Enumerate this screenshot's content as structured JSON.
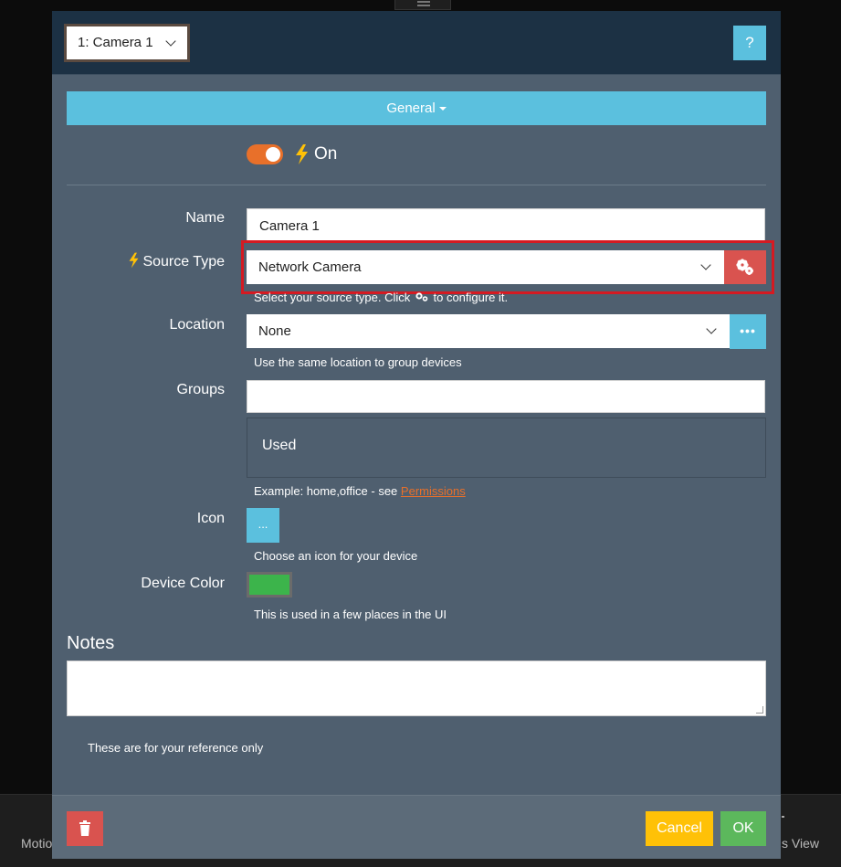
{
  "background": {
    "left_label": "Motio",
    "right_label": "s View"
  },
  "header": {
    "monitor_select_value": "1: Camera 1",
    "help_label": "?"
  },
  "tab": {
    "label": "General"
  },
  "enabled": {
    "state": true,
    "label": "On"
  },
  "fields": {
    "name": {
      "label": "Name",
      "value": "Camera 1"
    },
    "source_type": {
      "label": "Source Type",
      "value": "Network Camera",
      "help_before": "Select your source type. Click",
      "help_after": "to configure it."
    },
    "location": {
      "label": "Location",
      "value": "None",
      "more_label": "•••",
      "help": "Use the same location to group devices"
    },
    "groups": {
      "label": "Groups",
      "value": "",
      "used_label": "Used",
      "help_prefix": "Example: home,office - see",
      "help_link": "Permissions"
    },
    "icon": {
      "label": "Icon",
      "button_label": "...",
      "help": "Choose an icon for your device"
    },
    "device_color": {
      "label": "Device Color",
      "value": "#3cb44b",
      "help": "This is used in a few places in the UI"
    }
  },
  "notes": {
    "label": "Notes",
    "value": "",
    "help": "These are for your reference only"
  },
  "footer": {
    "cancel_label": "Cancel",
    "ok_label": "OK"
  },
  "colors": {
    "accent_info": "#5bc0de",
    "accent_danger": "#d9534f",
    "accent_warning": "#ffc107",
    "accent_success": "#5cb85c",
    "toggle_on": "#e8702a",
    "highlight": "#d51a22"
  },
  "icons": {
    "bolt": "lightning-bolt-icon",
    "cogs": "cogs-icon",
    "trash": "trash-icon",
    "chevron": "chevron-down-icon"
  }
}
